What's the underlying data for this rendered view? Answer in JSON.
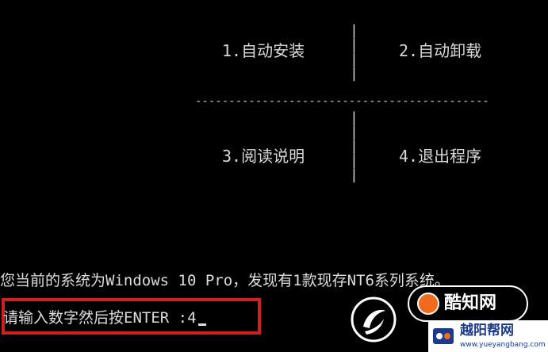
{
  "menu": {
    "item_install": "1.自动安装",
    "item_uninstall": "2.自动卸载",
    "item_readme": "3.阅读说明",
    "item_exit": "4.退出程序",
    "divider": "------------------------------------------------------------------------------"
  },
  "status": {
    "system_line": "您当前的系统为Windows 10 Pro，发现有1款现存NT6系列系统。",
    "prompt_line": "请输入数字然后按ENTER :4"
  },
  "watermark": {
    "badge_text": "酷知网",
    "site_title": "越阳帮网",
    "site_url": "www.yueyangbang.com"
  },
  "colors": {
    "background": "#000000",
    "text": "#d9d9d9",
    "highlight_border": "#d01f1f",
    "badge_accent": "#f06b1d"
  }
}
